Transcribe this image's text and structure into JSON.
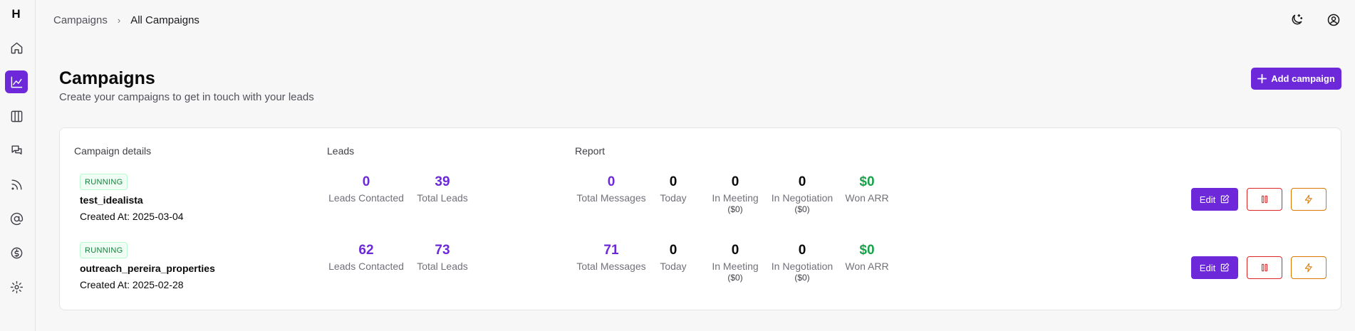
{
  "app": {
    "logo_letter": "H"
  },
  "sidebar": {
    "items": [
      {
        "name": "home",
        "icon": "home-icon",
        "active": false
      },
      {
        "name": "analytics",
        "icon": "chart-line-icon",
        "active": true
      },
      {
        "name": "columns",
        "icon": "columns-icon",
        "active": false
      },
      {
        "name": "messages",
        "icon": "chat-icon",
        "active": false
      },
      {
        "name": "feeds",
        "icon": "rss-icon",
        "active": false
      },
      {
        "name": "email",
        "icon": "at-sign-icon",
        "active": false
      },
      {
        "name": "billing",
        "icon": "dollar-circle-icon",
        "active": false
      },
      {
        "name": "settings",
        "icon": "gear-icon",
        "active": false
      }
    ]
  },
  "breadcrumb": {
    "parent": "Campaigns",
    "separator": "›",
    "current": "All Campaigns"
  },
  "topbar": {
    "theme_icon": "moon-stars-icon",
    "account_icon": "user-circle-icon"
  },
  "header": {
    "title": "Campaigns",
    "subtitle": "Create your campaigns to get in touch with your leads",
    "add_button": "Add campaign"
  },
  "table": {
    "columns": {
      "details": "Campaign details",
      "leads": "Leads",
      "report": "Report"
    },
    "rows": [
      {
        "status": "RUNNING",
        "name": "test_idealista",
        "created": "Created At: 2025-03-04",
        "leads_contacted": "0",
        "leads_contacted_label": "Leads Contacted",
        "total_leads": "39",
        "total_leads_label": "Total Leads",
        "total_messages": "0",
        "total_messages_label": "Total Messages",
        "today": "0",
        "today_label": "Today",
        "in_meeting": "0",
        "in_meeting_label": "In Meeting",
        "in_meeting_value": "($0)",
        "in_negotiation": "0",
        "in_negotiation_label": "In Negotiation",
        "in_negotiation_value": "($0)",
        "won_arr": "$0",
        "won_arr_label": "Won ARR",
        "edit_label": "Edit"
      },
      {
        "status": "RUNNING",
        "name": "outreach_pereira_properties",
        "created": "Created At: 2025-02-28",
        "leads_contacted": "62",
        "leads_contacted_label": "Leads Contacted",
        "total_leads": "73",
        "total_leads_label": "Total Leads",
        "total_messages": "71",
        "total_messages_label": "Total Messages",
        "today": "0",
        "today_label": "Today",
        "in_meeting": "0",
        "in_meeting_label": "In Meeting",
        "in_meeting_value": "($0)",
        "in_negotiation": "0",
        "in_negotiation_label": "In Negotiation",
        "in_negotiation_value": "($0)",
        "won_arr": "$0",
        "won_arr_label": "Won ARR",
        "edit_label": "Edit"
      }
    ]
  },
  "colors": {
    "accent": "#6d28d9",
    "success": "#16a34a",
    "danger": "#dc2626",
    "warning": "#d97706"
  }
}
